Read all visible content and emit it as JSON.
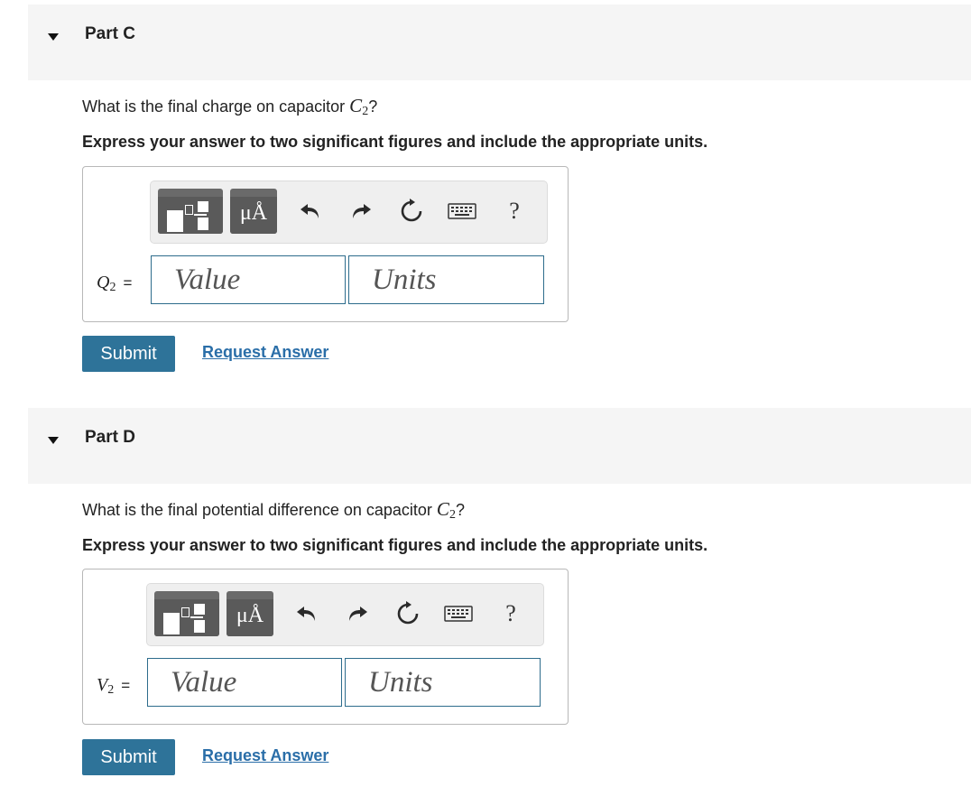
{
  "parts": [
    {
      "title": "Part C",
      "question_prefix": "What is the final charge on capacitor",
      "question_var": "C",
      "question_sub": "2",
      "question_suffix": "?",
      "instruction": "Express your answer to two significant figures and include the appropriate units.",
      "var_symbol": "Q",
      "var_sub": "2",
      "equals": "=",
      "value_placeholder": "Value",
      "units_placeholder": "Units",
      "submit_label": "Submit",
      "request_label": "Request Answer"
    },
    {
      "title": "Part D",
      "question_prefix": "What is the final potential difference on capacitor",
      "question_var": "C",
      "question_sub": "2",
      "question_suffix": "?",
      "instruction": "Express your answer to two significant figures and include the appropriate units.",
      "var_symbol": "V",
      "var_sub": "2",
      "equals": "=",
      "value_placeholder": "Value",
      "units_placeholder": "Units",
      "submit_label": "Submit",
      "request_label": "Request Answer"
    }
  ],
  "toolbar": {
    "units_glyph": "μÅ",
    "help_glyph": "?",
    "icons": [
      "templates-icon",
      "units-icon",
      "undo-icon",
      "redo-icon",
      "reset-icon",
      "keyboard-icon",
      "help-icon"
    ]
  },
  "colors": {
    "header_bg": "#f5f5f5",
    "submit_bg": "#2e7399",
    "link": "#2a6ea8",
    "field_border": "#2d6c8c"
  }
}
